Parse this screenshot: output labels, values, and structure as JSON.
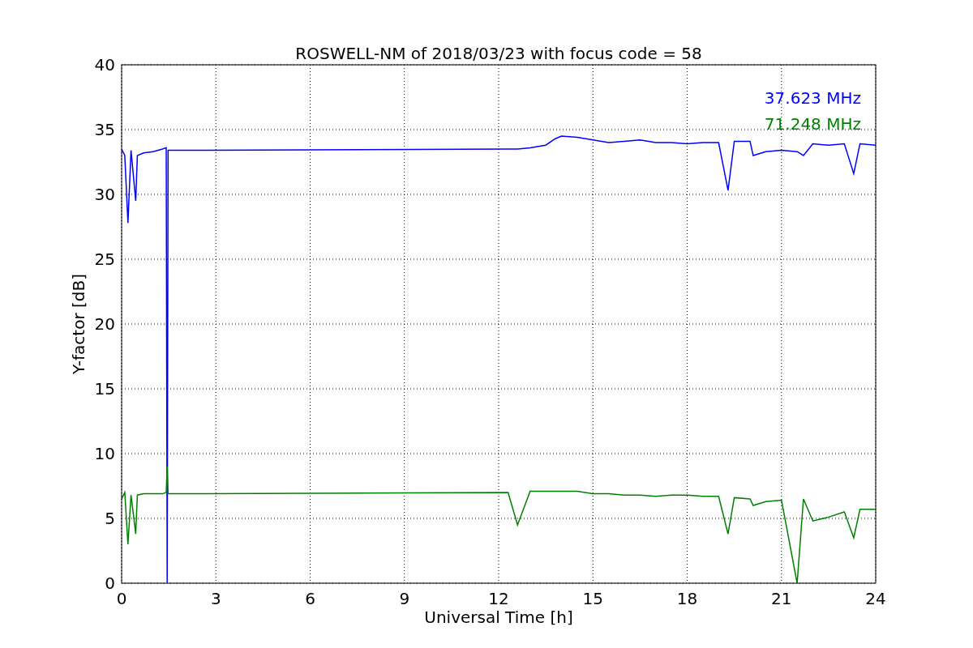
{
  "chart_data": {
    "type": "line",
    "title": "ROSWELL-NM of 2018/03/23 with focus code = 58",
    "xlabel": "Universal Time [h]",
    "ylabel": "Y-factor [dB]",
    "x": [
      0,
      0.1,
      0.2,
      0.3,
      0.45,
      0.5,
      0.7,
      1.0,
      1.3,
      1.42,
      1.45,
      1.48,
      1.5,
      12.3,
      12.6,
      13,
      13.5,
      13.8,
      14,
      14.5,
      15,
      15.5,
      16,
      16.5,
      17,
      17.5,
      18,
      18.5,
      19,
      19.3,
      19.5,
      20,
      20.1,
      20.5,
      21,
      21.5,
      21.7,
      22,
      22.5,
      23,
      23.3,
      23.5,
      24
    ],
    "series": [
      {
        "name": "37.623 MHz",
        "color": "#0000ff",
        "values": [
          33.5,
          33,
          27.8,
          33.4,
          29.5,
          33,
          33.2,
          33.3,
          33.5,
          33.6,
          0,
          33.4,
          33.4,
          33.5,
          33.5,
          33.6,
          33.8,
          34.3,
          34.5,
          34.4,
          34.2,
          34,
          34.1,
          34.2,
          34,
          34,
          33.9,
          34,
          34,
          30.3,
          34.1,
          34.1,
          33,
          33.3,
          33.4,
          33.3,
          33,
          33.9,
          33.8,
          33.9,
          31.6,
          33.9,
          33.8
        ]
      },
      {
        "name": "71.248 MHz",
        "color": "#008000",
        "values": [
          6.5,
          7,
          3,
          6.8,
          3.8,
          6.8,
          6.9,
          6.9,
          6.9,
          7,
          9,
          6.9,
          6.9,
          7,
          4.5,
          7.1,
          7.1,
          7.1,
          7.1,
          7.1,
          6.9,
          6.9,
          6.8,
          6.8,
          6.7,
          6.8,
          6.8,
          6.7,
          6.7,
          3.8,
          6.6,
          6.5,
          6,
          6.3,
          6.4,
          0,
          6.5,
          4.8,
          5.1,
          5.5,
          3.5,
          5.7,
          5.7
        ]
      }
    ],
    "grid": true,
    "xlim": [
      0,
      24
    ],
    "ylim": [
      0,
      40
    ],
    "xticks": [
      0,
      3,
      6,
      9,
      12,
      15,
      18,
      21,
      24
    ],
    "yticks": [
      0,
      5,
      10,
      15,
      20,
      25,
      30,
      35,
      40
    ]
  }
}
